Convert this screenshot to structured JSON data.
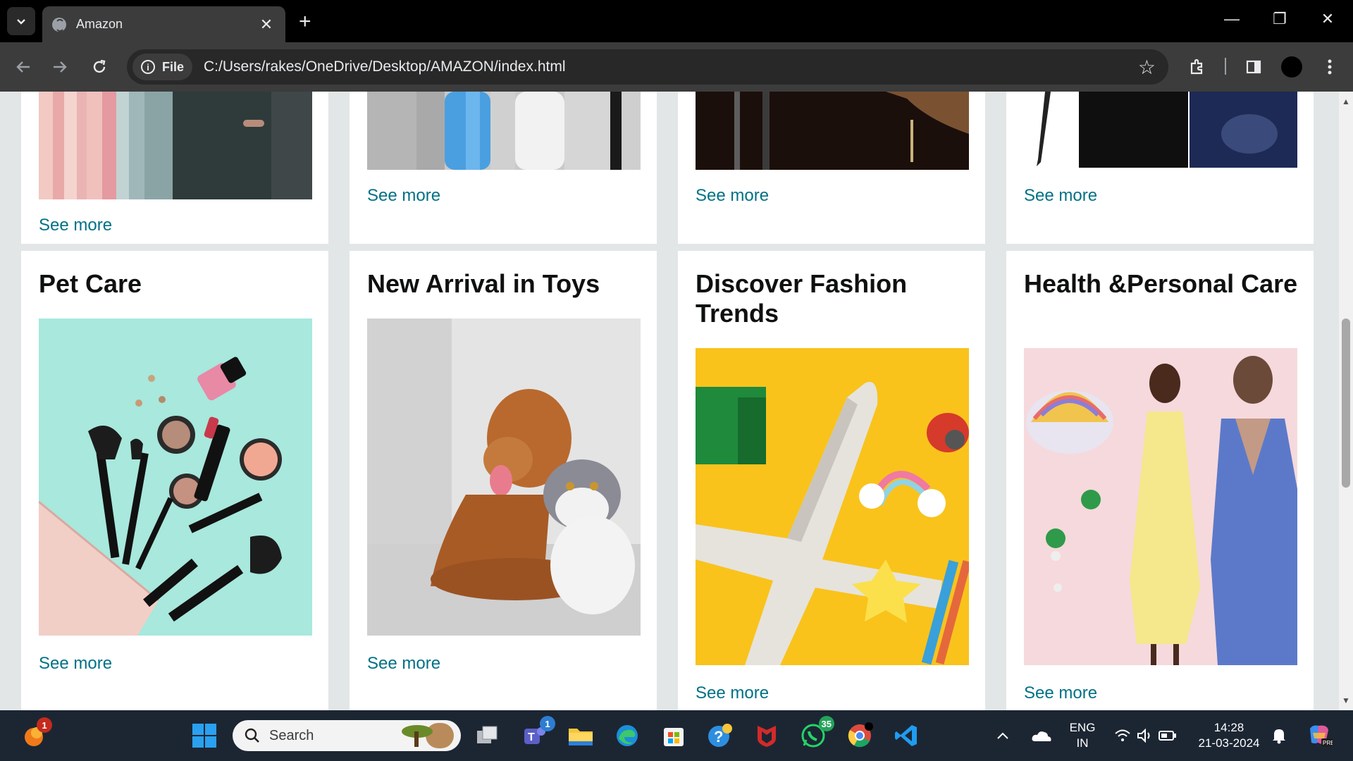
{
  "browser": {
    "tab_title": "Amazon",
    "site_chip": "File",
    "url": "C:/Users/rakes/OneDrive/Desktop/AMAZON/index.html"
  },
  "cards_top": [
    {
      "link": "See more"
    },
    {
      "link": "See more"
    },
    {
      "link": "See more"
    },
    {
      "link": "See more"
    }
  ],
  "cards": [
    {
      "title": "Pet Care",
      "link": "See more"
    },
    {
      "title": "New Arrival in Toys",
      "link": "See more"
    },
    {
      "title": "Discover Fashion Trends",
      "link": "See more"
    },
    {
      "title": "Health &Personal Care",
      "link": "See more"
    }
  ],
  "taskbar": {
    "search_placeholder": "Search",
    "badges": {
      "notifications": "1",
      "teams": "1",
      "whatsapp": "35"
    },
    "lang_line1": "ENG",
    "lang_line2": "IN",
    "time": "14:28",
    "date": "21-03-2024"
  },
  "colors": {
    "link": "#007185",
    "page_bg": "#e3e6e6",
    "taskbar": "#1c2633"
  }
}
